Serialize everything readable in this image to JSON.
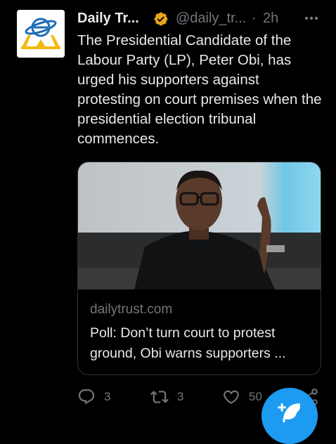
{
  "tweet": {
    "author_name": "Daily Tr...",
    "handle": "@daily_tr...",
    "separator": "·",
    "time": "2h",
    "more_icon": "ellipsis-icon",
    "verified_color": "#e8a319",
    "text": "The Presidential Candidate of the Labour Party (LP), Peter Obi, has urged his supporters against protesting on court premises when the presidential election tribunal commences."
  },
  "card": {
    "domain": "dailytrust.com",
    "title": "Poll: Don’t turn court to protest ground, Obi warns supporters ..."
  },
  "actions": {
    "replies": "3",
    "retweets": "3",
    "likes": "50"
  },
  "colors": {
    "background": "#000000",
    "text": "#e7e9ea",
    "muted": "#71767b",
    "accent": "#1d9bf0"
  }
}
